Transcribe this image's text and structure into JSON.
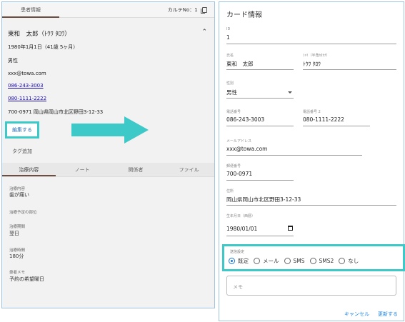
{
  "left": {
    "tab_patient": "患者情報",
    "karte_no": "カルテNo：1",
    "name": "東和　太郎（ﾄｳﾜ ﾀﾛｳ）",
    "birth": "1980年1月1日（41歳 5ヶ月）",
    "gender": "男性",
    "email": "xxx@towa.com",
    "phone1": "086-243-3003",
    "phone2": "080-1111-2222",
    "address": "700-0971 岡山県岡山市北区野田3-12-33",
    "edit_button": "編集する",
    "tag_add": "タグ追加",
    "tabs": [
      "治療内容",
      "ノート",
      "関係者",
      "ファイル"
    ],
    "details": [
      {
        "label": "治療内容",
        "value": "歯が痛い"
      },
      {
        "label": "治療予定の部位",
        "value": ""
      },
      {
        "label": "治療期間",
        "value": "翌日"
      },
      {
        "label": "治療時間",
        "value": "180分"
      },
      {
        "label": "患者メモ",
        "value": "予約の希望曜日"
      }
    ]
  },
  "right": {
    "title": "カード情報",
    "id_label": "ID",
    "id_value": "1",
    "name_label": "氏名",
    "name_value": "東和　太郎",
    "kana_label": "ｼﾒｲ（半角ｶﾀｶﾅ）",
    "kana_value": "ﾄｳﾜ ﾀﾛｳ",
    "gender_label": "性別",
    "gender_value": "男性",
    "phone1_label": "電話番号",
    "phone1_value": "086-243-3003",
    "phone2_label": "電話番号 2",
    "phone2_value": "080-1111-2222",
    "email_label": "メールアドレス",
    "email_value": "xxx@towa.com",
    "zip_label": "郵便番号",
    "zip_value": "700-0971",
    "address_label": "住所",
    "address_value": "岡山県岡山市北区野田3-12-33",
    "birth_label": "生年月日（西暦）",
    "birth_value": "1980/01/01",
    "send_label": "送信設定",
    "send_options": [
      "既定",
      "メール",
      "SMS",
      "SMS2",
      "なし"
    ],
    "send_selected": "既定",
    "memo_placeholder": "メモ",
    "cancel": "キャンセル",
    "update": "更新する"
  },
  "colors": {
    "highlight": "#3ec9c9",
    "link": "#1a0dab",
    "accent": "#1976d2"
  }
}
